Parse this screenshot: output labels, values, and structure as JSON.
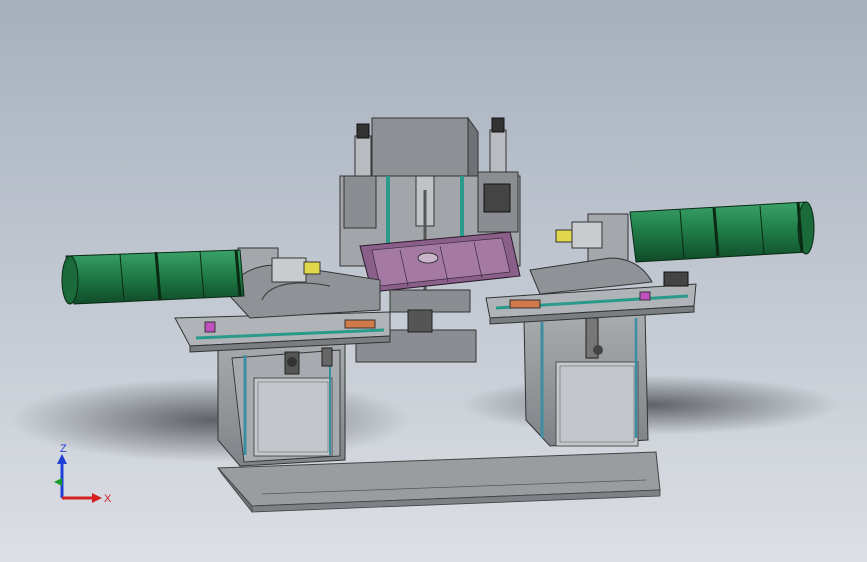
{
  "viewport": {
    "background_top": "#a6b0bd",
    "background_bottom": "#dcdfe4"
  },
  "triad": {
    "z_label": "Z",
    "x_label": "X",
    "z_color": "#1f3fd6",
    "x_color": "#d42020",
    "y_color": "#1a9a2a"
  },
  "colors": {
    "frame_gray": "#8e9296",
    "plate_gray": "#b4b7ba",
    "cylinder_green": "#1f7a45",
    "fixture_purple": "#8a5f8a",
    "rail_teal": "#2a9a8a",
    "accent_yellow": "#e0d84a",
    "accent_orange": "#d07a4a"
  }
}
